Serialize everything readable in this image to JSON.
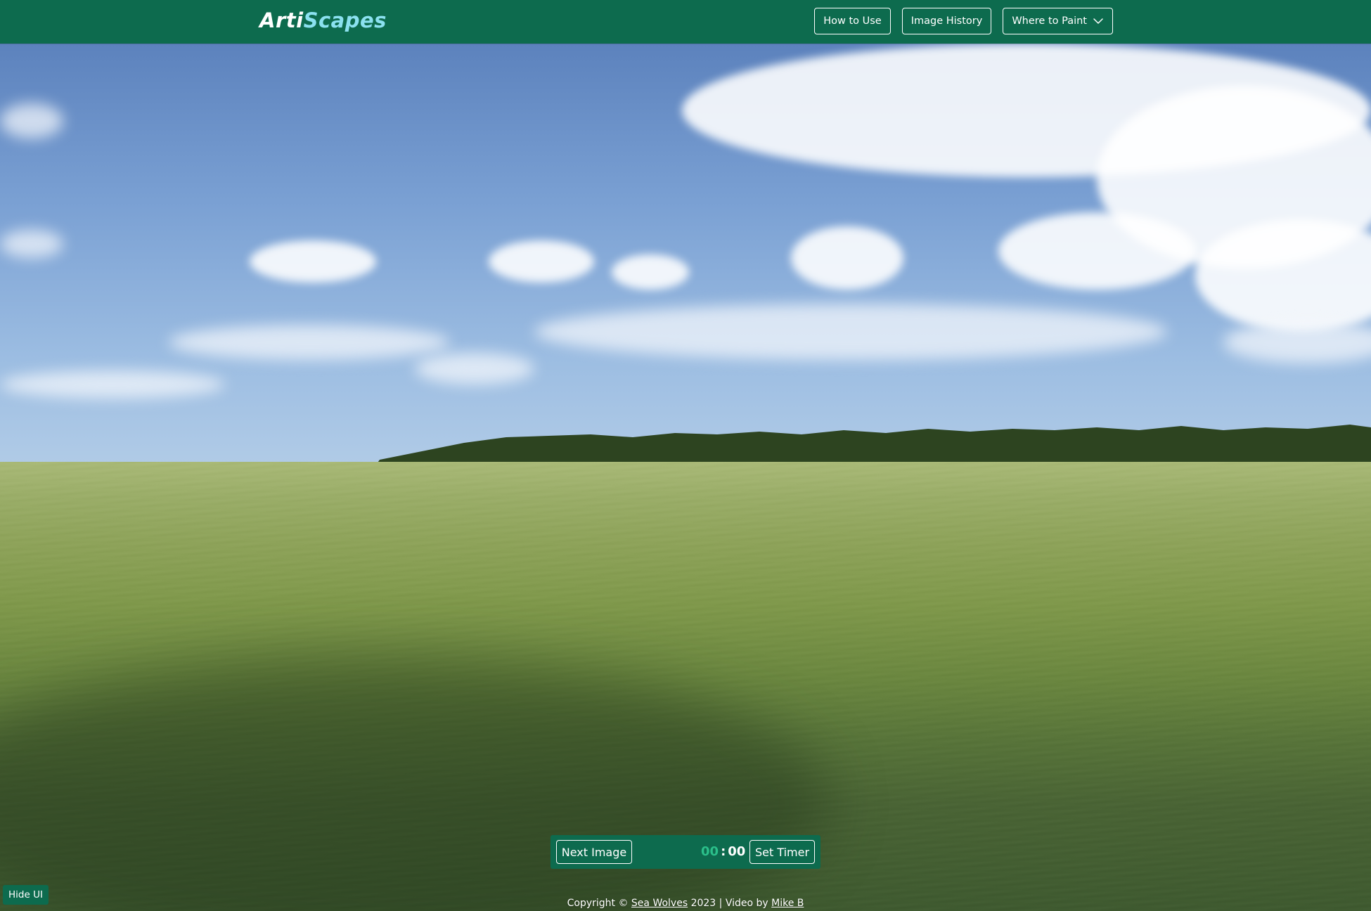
{
  "header": {
    "logo_part1": "Arti",
    "logo_part2": "Scapes",
    "nav": {
      "how_to_use": "How to Use",
      "image_history": "Image History",
      "where_to_paint": "Where to Paint"
    }
  },
  "controls": {
    "next_image": "Next Image",
    "timer_minutes": "00",
    "timer_separator": ":",
    "timer_seconds": "00",
    "set_timer": "Set Timer"
  },
  "hide_ui": "Hide UI",
  "footer": {
    "prefix": "Copyright © ",
    "author_link": "Sea Wolves",
    "middle": " 2023 | Video by ",
    "video_link": "Mike B"
  },
  "colors": {
    "brand_green": "#0d6b4e",
    "logo_accent": "#8be1f0",
    "timer_minutes": "#2bbf8a"
  },
  "icons": {
    "dropdown": "chevron-down-icon"
  }
}
